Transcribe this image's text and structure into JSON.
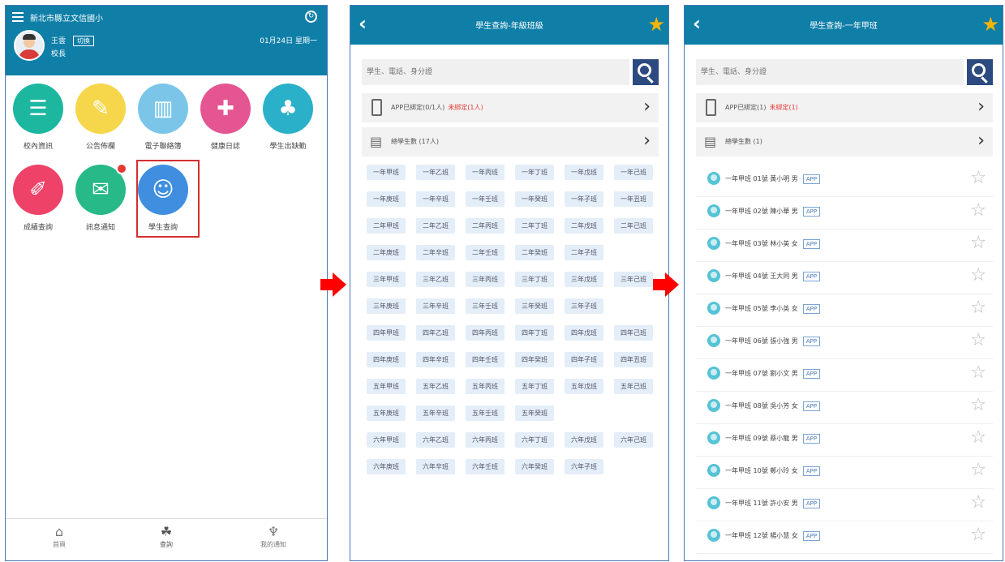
{
  "home": {
    "school_name": "新北市縣立文信國小",
    "user_name": "王雲",
    "switch_label": "切換",
    "user_role": "校長",
    "date": "01月24日 星期一",
    "apps": [
      {
        "label": "校內資訊",
        "color": "#1db7a0",
        "icon": "☰"
      },
      {
        "label": "公告佈欄",
        "color": "#f6d64a",
        "icon": "✎"
      },
      {
        "label": "電子聯絡簿",
        "color": "#7bc6e8",
        "icon": "▥"
      },
      {
        "label": "健康日誌",
        "color": "#e55592",
        "icon": "✚"
      },
      {
        "label": "學生出缺勤",
        "color": "#2ab0c9",
        "icon": "♣"
      },
      {
        "label": "成績查詢",
        "color": "#ee4268",
        "icon": "✐"
      },
      {
        "label": "訊息通知",
        "color": "#27b988",
        "icon": "✉"
      },
      {
        "label": "學生查詢",
        "color": "#3f8ee0",
        "icon": "☺"
      }
    ],
    "nav": [
      {
        "label": "首頁",
        "icon": "⌂"
      },
      {
        "label": "查詢",
        "icon": "☘"
      },
      {
        "label": "我的通知",
        "icon": "♆"
      }
    ]
  },
  "classes_screen": {
    "title": "學生查詢-年級班級",
    "search_placeholder": "學生、電話、身分證",
    "app_row": {
      "text": "APP已綁定(0/1人)",
      "warn": "未綁定(1人)"
    },
    "total_row": {
      "text": "總學生數 (17人)"
    },
    "chips": [
      [
        "一年甲班",
        "一年乙班",
        "一年丙班",
        "一年丁班",
        "一年戊班",
        "一年己班"
      ],
      [
        "一年庚班",
        "一年辛班",
        "一年壬班",
        "一年癸班",
        "一年子班",
        "一年丑班"
      ],
      [
        "二年甲班",
        "二年乙班",
        "二年丙班",
        "二年丁班",
        "二年戊班",
        "二年己班"
      ],
      [
        "二年庚班",
        "二年辛班",
        "二年壬班",
        "二年癸班",
        "二年子班"
      ],
      [
        "三年甲班",
        "三年乙班",
        "三年丙班",
        "三年丁班",
        "三年戊班",
        "三年己班"
      ],
      [
        "三年庚班",
        "三年辛班",
        "三年壬班",
        "三年癸班",
        "三年子班"
      ],
      [
        "四年甲班",
        "四年乙班",
        "四年丙班",
        "四年丁班",
        "四年戊班",
        "四年己班"
      ],
      [
        "四年庚班",
        "四年辛班",
        "四年壬班",
        "四年癸班",
        "四年子班",
        "四年丑班"
      ],
      [
        "五年甲班",
        "五年乙班",
        "五年丙班",
        "五年丁班",
        "五年戊班",
        "五年己班"
      ],
      [
        "五年庚班",
        "五年辛班",
        "五年壬班",
        "五年癸班"
      ],
      [
        "六年甲班",
        "六年乙班",
        "六年丙班",
        "六年丁班",
        "六年戊班",
        "六年己班"
      ],
      [
        "六年庚班",
        "六年辛班",
        "六年壬班",
        "六年癸班",
        "六年子班"
      ]
    ]
  },
  "students_screen": {
    "title": "學生查詢-一年甲班",
    "search_placeholder": "學生、電話、身分證",
    "app_row": {
      "text": "APP已綁定(1)",
      "warn": "未綁定(1)"
    },
    "total_row": {
      "text": "總學生數 (1)"
    },
    "app_tag": "APP",
    "students": [
      "一年甲班 01號 黃小明 男",
      "一年甲班 02號 陳小華 男",
      "一年甲班 03號 林小美 女",
      "一年甲班 04號 王大同 男",
      "一年甲班 05號 李小英 女",
      "一年甲班 06號 張小強 男",
      "一年甲班 07號 劉小文 男",
      "一年甲班 08號 吳小芳 女",
      "一年甲班 09號 蔡小龍 男",
      "一年甲班 10號 鄭小玲 女",
      "一年甲班 11號 許小安 男",
      "一年甲班 12號 楊小慧 女"
    ]
  }
}
